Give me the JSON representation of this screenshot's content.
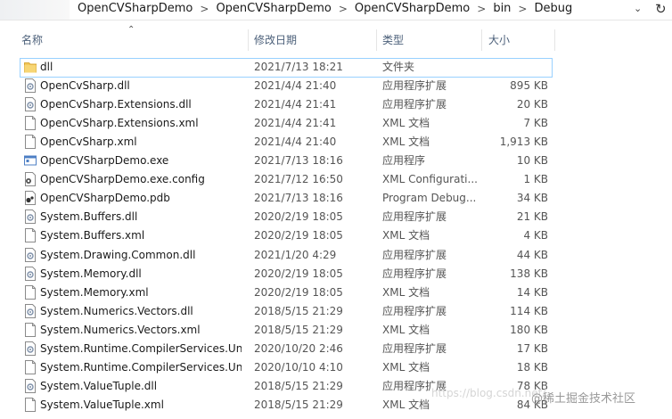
{
  "address": {
    "crumbs": [
      "OpenCVSharpDemo",
      "OpenCVSharpDemo",
      "OpenCVSharpDemo",
      "bin",
      "Debug"
    ],
    "separator": ">"
  },
  "columns": {
    "name": "名称",
    "date": "修改日期",
    "type": "类型",
    "size": "大小"
  },
  "files": [
    {
      "name": "dll",
      "date": "2021/7/13 18:21",
      "type": "文件夹",
      "size": "",
      "icon": "folder-icon"
    },
    {
      "name": "OpenCvSharp.dll",
      "date": "2021/4/4 21:40",
      "type": "应用程序扩展",
      "size": "895 KB",
      "icon": "dll-icon"
    },
    {
      "name": "OpenCvSharp.Extensions.dll",
      "date": "2021/4/4 21:41",
      "type": "应用程序扩展",
      "size": "20 KB",
      "icon": "dll-icon"
    },
    {
      "name": "OpenCvSharp.Extensions.xml",
      "date": "2021/4/4 21:41",
      "type": "XML 文档",
      "size": "7 KB",
      "icon": "xml-icon"
    },
    {
      "name": "OpenCvSharp.xml",
      "date": "2021/4/4 21:40",
      "type": "XML 文档",
      "size": "1,913 KB",
      "icon": "xml-icon"
    },
    {
      "name": "OpenCVSharpDemo.exe",
      "date": "2021/7/13 18:16",
      "type": "应用程序",
      "size": "10 KB",
      "icon": "exe-icon"
    },
    {
      "name": "OpenCVSharpDemo.exe.config",
      "date": "2021/7/12 16:50",
      "type": "XML Configurati...",
      "size": "1 KB",
      "icon": "config-icon"
    },
    {
      "name": "OpenCVSharpDemo.pdb",
      "date": "2021/7/13 18:16",
      "type": "Program Debug...",
      "size": "34 KB",
      "icon": "pdb-icon"
    },
    {
      "name": "System.Buffers.dll",
      "date": "2020/2/19 18:05",
      "type": "应用程序扩展",
      "size": "21 KB",
      "icon": "dll-icon"
    },
    {
      "name": "System.Buffers.xml",
      "date": "2020/2/19 18:05",
      "type": "XML 文档",
      "size": "4 KB",
      "icon": "xml-icon"
    },
    {
      "name": "System.Drawing.Common.dll",
      "date": "2021/1/20 4:29",
      "type": "应用程序扩展",
      "size": "44 KB",
      "icon": "dll-icon"
    },
    {
      "name": "System.Memory.dll",
      "date": "2020/2/19 18:05",
      "type": "应用程序扩展",
      "size": "138 KB",
      "icon": "dll-icon"
    },
    {
      "name": "System.Memory.xml",
      "date": "2020/2/19 18:05",
      "type": "XML 文档",
      "size": "14 KB",
      "icon": "xml-icon"
    },
    {
      "name": "System.Numerics.Vectors.dll",
      "date": "2018/5/15 21:29",
      "type": "应用程序扩展",
      "size": "114 KB",
      "icon": "dll-icon"
    },
    {
      "name": "System.Numerics.Vectors.xml",
      "date": "2018/5/15 21:29",
      "type": "XML 文档",
      "size": "180 KB",
      "icon": "xml-icon"
    },
    {
      "name": "System.Runtime.CompilerServices.Un...",
      "date": "2020/10/20 2:46",
      "type": "应用程序扩展",
      "size": "17 KB",
      "icon": "dll-icon"
    },
    {
      "name": "System.Runtime.CompilerServices.Un...",
      "date": "2020/10/10 4:10",
      "type": "XML 文档",
      "size": "18 KB",
      "icon": "xml-icon"
    },
    {
      "name": "System.ValueTuple.dll",
      "date": "2018/5/15 21:29",
      "type": "应用程序扩展",
      "size": "78 KB",
      "icon": "dll-icon"
    },
    {
      "name": "System.ValueTuple.xml",
      "date": "2018/5/15 21:29",
      "type": "XML 文档",
      "size": "84 KB",
      "icon": "xml-icon"
    }
  ],
  "watermark": {
    "faint": "https://blog.csdn.net/",
    "brand": "@稀土掘金技术社区"
  },
  "colors": {
    "selection_border": "#99d1ff",
    "folder": "#f2c85b",
    "header_text": "#4c607a"
  }
}
